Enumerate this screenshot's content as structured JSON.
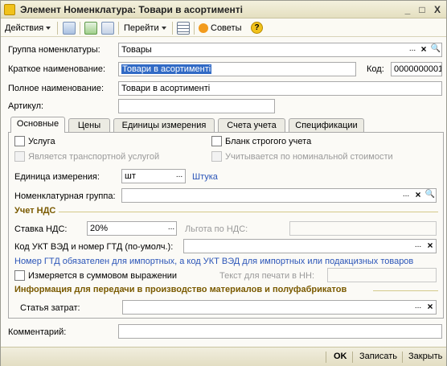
{
  "window": {
    "title": "Элемент Номенклатура: Товари в асортименті",
    "minimize": "_",
    "maximize": "□",
    "close": "X"
  },
  "toolbar": {
    "actions": "Действия",
    "goto": "Перейти",
    "tips": "Советы",
    "help": "?"
  },
  "fields": {
    "group_label": "Группа номенклатуры:",
    "group_value": "Товары",
    "short_label": "Краткое наименование:",
    "short_value": "Товари в асортименті",
    "code_label": "Код:",
    "code_value": "0000000001",
    "full_label": "Полное наименование:",
    "full_value": "Товари в асортименті",
    "article_label": "Артикул:",
    "article_value": ""
  },
  "tabs": [
    {
      "label": "Основные"
    },
    {
      "label": "Цены"
    },
    {
      "label": "Единицы измерения"
    },
    {
      "label": "Счета учета"
    },
    {
      "label": "Спецификации"
    }
  ],
  "main": {
    "service_label": "Услуга",
    "transport_label": "Является транспортной услугой",
    "strict_label": "Бланк строгого учета",
    "nominal_label": "Учитывается по номинальной стоимости",
    "unit_label": "Единица измерения:",
    "unit_value": "шт",
    "unit_link": "Штука",
    "nomgroup_label": "Номенклатурная группа:",
    "nomgroup_value": "",
    "vat_section": "Учет НДС",
    "vat_rate_label": "Ставка НДС:",
    "vat_rate_value": "20%",
    "vat_benefit_label": "Льгота по НДС:",
    "vat_benefit_value": "",
    "ukt_label": "Код УКТ ВЭД и номер ГТД (по-умолч.):",
    "ukt_value": "",
    "ukt_note": "Номер ГТД обязателен для импортных, а код УКТ ВЭД для импортных или подакцизных товаров",
    "summary_label": "Измеряется в суммовом выражении",
    "print_text_label": "Текст для печати в НН:",
    "print_text_value": "",
    "production_section": "Информация для передачи в производство материалов и полуфабрикатов",
    "cost_item_label": "Статья затрат:",
    "cost_item_value": ""
  },
  "comment": {
    "label": "Комментарий:",
    "value": ""
  },
  "bottom": {
    "ok": "OK",
    "save": "Записать",
    "close": "Закрыть"
  }
}
